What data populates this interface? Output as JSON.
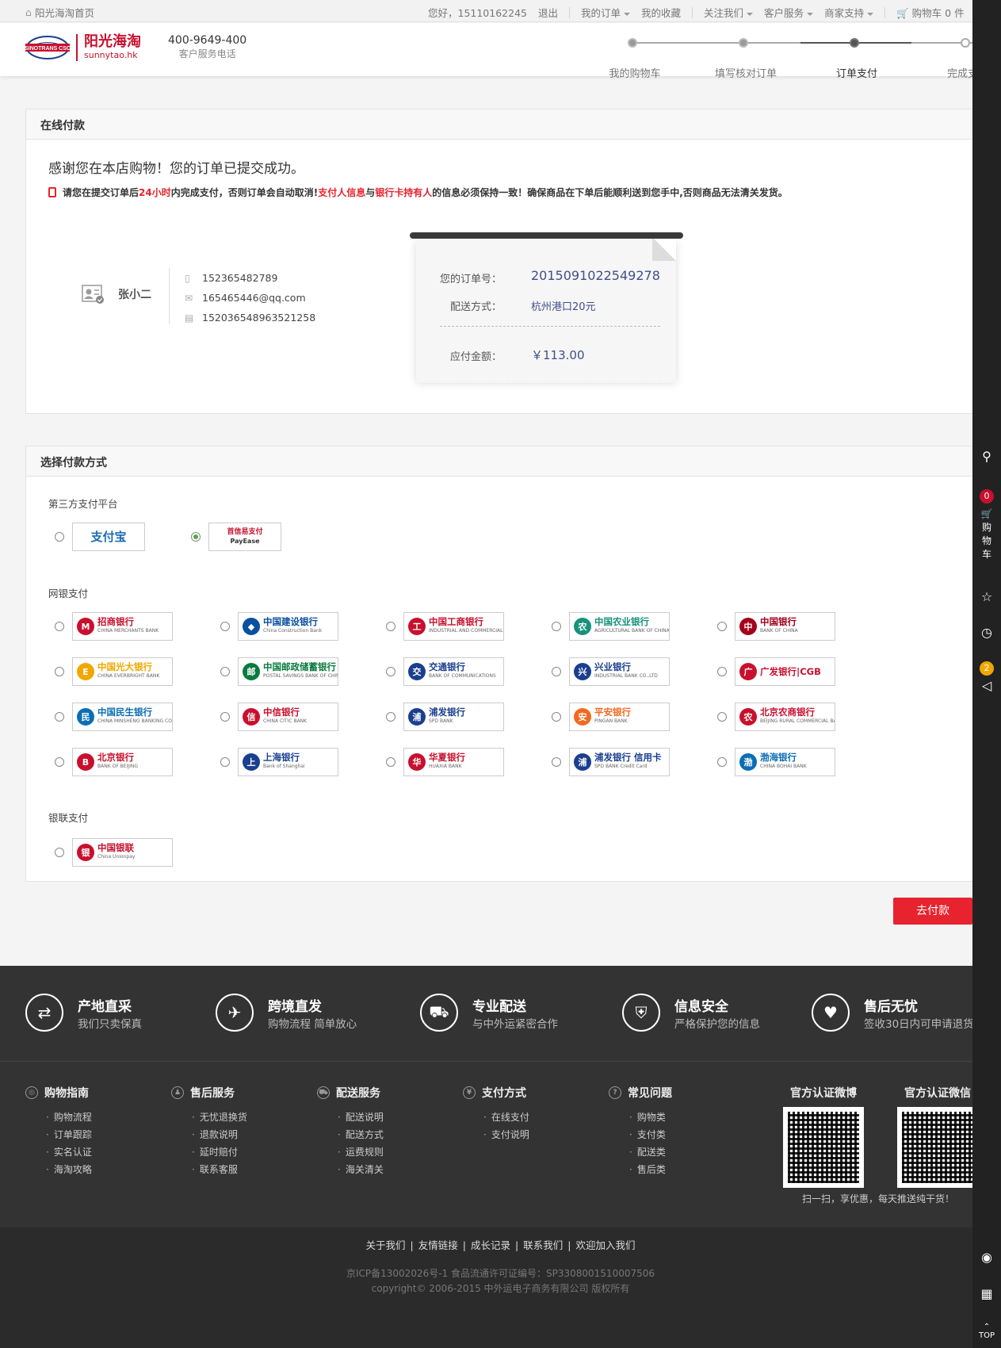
{
  "topbar": {
    "home": "阳光海淘首页",
    "greeting": "您好，15110162245",
    "logout": "退出",
    "my_orders": "我的订单",
    "favorites": "我的收藏",
    "follow": "关注我们",
    "service": "客户服务",
    "merchant": "商家支持",
    "cart": "购物车",
    "cart_count": "0",
    "cart_unit": "件"
  },
  "header": {
    "logo_mark": "SINOTRANS CSC",
    "brand_cn": "阳光海淘",
    "brand_en": "sunnytao.hk",
    "hotline": "400-9649-400",
    "hotline_label": "客户服务电话",
    "steps": [
      "我的购物车",
      "填写核对订单",
      "订单支付",
      "完成支付"
    ],
    "active_step": 2
  },
  "online_pay": {
    "title": "在线付款",
    "thanks": "感谢您在本店购物！您的订单已提交成功。",
    "notice_1": "请您在提交订单后",
    "notice_hours": "24小时",
    "notice_2": "内完成支付，否则订单会自动取消!",
    "notice_payer": "支付人信息",
    "notice_and": "与",
    "notice_holder": "银行卡持有人",
    "notice_3": "的信息必须保持一致！确保商品在下单后能顺利送到您手中,否则商品无法清关发货。",
    "name": "张小二",
    "phone": "152365482789",
    "email": "165465446@qq.com",
    "id_no": "152036548963521258",
    "order_label": "您的订单号：",
    "order_no": "2015091022549278",
    "ship_label": "配送方式：",
    "ship_value": "杭州港口20元",
    "amount_label": "应付金额：",
    "amount_value": "￥113.00"
  },
  "pay_method": {
    "title": "选择付款方式",
    "third_party_label": "第三方支付平台",
    "third_party": [
      {
        "name": "支付宝",
        "sub": "",
        "color": "#1a6bb4",
        "checked": false
      },
      {
        "name": "首信易支付",
        "sub": "PayEase",
        "color": "#c8102e",
        "checked": true
      }
    ],
    "netbank_label": "网银支付",
    "banks": [
      {
        "name": "招商银行",
        "sub": "CHINA MERCHANTS BANK",
        "color": "#c8102e",
        "mark": "M"
      },
      {
        "name": "中国建设银行",
        "sub": "China Construction Bank",
        "color": "#0b4fa1",
        "mark": "◆"
      },
      {
        "name": "中国工商银行",
        "sub": "INDUSTRIAL AND COMMERCIAL BANK OF CHINA",
        "color": "#c8102e",
        "mark": "工"
      },
      {
        "name": "中国农业银行",
        "sub": "AGRICULTURAL BANK OF CHINA",
        "color": "#16927d",
        "mark": "农"
      },
      {
        "name": "中国银行",
        "sub": "BANK OF CHINA",
        "color": "#a3001b",
        "mark": "中"
      },
      {
        "name": "中国光大银行",
        "sub": "CHINA EVERBRIGHT BANK",
        "color": "#f0a800",
        "mark": "E"
      },
      {
        "name": "中国邮政储蓄银行",
        "sub": "POSTAL SAVINGS BANK OF CHINA",
        "color": "#0a7a3e",
        "mark": "邮"
      },
      {
        "name": "交通银行",
        "sub": "BANK OF COMMUNICATIONS",
        "color": "#1b3f8f",
        "mark": "交"
      },
      {
        "name": "兴业银行",
        "sub": "INDUSTRIAL BANK CO.,LTD",
        "color": "#1b3f8f",
        "mark": "兴"
      },
      {
        "name": "广发银行|CGB",
        "sub": "",
        "color": "#c8102e",
        "mark": "广"
      },
      {
        "name": "中国民生银行",
        "sub": "CHINA MINSHENG BANKING CORP.,LTD",
        "color": "#0a6eb4",
        "mark": "民"
      },
      {
        "name": "中信银行",
        "sub": "CHINA CITIC BANK",
        "color": "#c8102e",
        "mark": "信"
      },
      {
        "name": "浦发银行",
        "sub": "SPD BANK",
        "color": "#1b3f8f",
        "mark": "浦"
      },
      {
        "name": "平安银行",
        "sub": "PINGAN BANK",
        "color": "#f26a21",
        "mark": "安"
      },
      {
        "name": "北京农商银行",
        "sub": "BEIJING RURAL COMMERCIAL BANK",
        "color": "#c8102e",
        "mark": "农"
      },
      {
        "name": "北京银行",
        "sub": "BANK OF BEIJING",
        "color": "#c8102e",
        "mark": "B"
      },
      {
        "name": "上海银行",
        "sub": "Bank of Shanghai",
        "color": "#1b3f8f",
        "mark": "上"
      },
      {
        "name": "华夏银行",
        "sub": "HUAXIA BANK",
        "color": "#c8102e",
        "mark": "华"
      },
      {
        "name": "浦发银行 信用卡",
        "sub": "SPD BANK Credit Card",
        "color": "#1b3f8f",
        "mark": "浦"
      },
      {
        "name": "渤海银行",
        "sub": "CHINA BOHAI BANK",
        "color": "#0a6eb4",
        "mark": "渤"
      }
    ],
    "unionpay_label": "银联支付",
    "unionpay": {
      "name": "中国银联",
      "sub": "China Unionpay",
      "color": "#c8102e",
      "mark": "银"
    },
    "pay_button": "去付款"
  },
  "features": [
    {
      "title": "产地直采",
      "desc": "我们只卖保真",
      "icon": "⇄"
    },
    {
      "title": "跨境直发",
      "desc": "购物流程 简单放心",
      "icon": "✈"
    },
    {
      "title": "专业配送",
      "desc": "与中外运紧密合作",
      "icon": "⛟"
    },
    {
      "title": "信息安全",
      "desc": "严格保护您的信息",
      "icon": "⛨"
    },
    {
      "title": "售后无忧",
      "desc": "签收30日内可申请退货",
      "icon": "♥"
    }
  ],
  "footer_cols": [
    {
      "title": "购物指南",
      "icon": "◎",
      "items": [
        "购物流程",
        "订单跟踪",
        "实名认证",
        "海淘攻略"
      ]
    },
    {
      "title": "售后服务",
      "icon": "♟",
      "items": [
        "无忧退换货",
        "退款说明",
        "延时赔付",
        "联系客服"
      ]
    },
    {
      "title": "配送服务",
      "icon": "⛟",
      "items": [
        "配送说明",
        "配送方式",
        "运费规则",
        "海关清关"
      ]
    },
    {
      "title": "支付方式",
      "icon": "¥",
      "items": [
        "在线支付",
        "支付说明"
      ]
    },
    {
      "title": "常见问题",
      "icon": "?",
      "items": [
        "购物类",
        "支付类",
        "配送类",
        "售后类"
      ]
    }
  ],
  "qr": {
    "weibo": "官方认证微博",
    "wechat": "官方认证微信",
    "note": "扫一扫，享优惠，每天推送纯干货！"
  },
  "bottom": {
    "links": [
      "关于我们",
      "友情链接",
      "成长记录",
      "联系我们",
      "欢迎加入我们"
    ],
    "icp": "京ICP备13002026号-1   食品流通许可证编号：SP3308001510007506",
    "copyright": "copyright© 2006-2015 中外运电子商务有限公司  版权所有"
  },
  "sidebar": {
    "cart_count": "0",
    "cart_label": "购物车",
    "msg_count": "2",
    "top_label": "TOP"
  }
}
